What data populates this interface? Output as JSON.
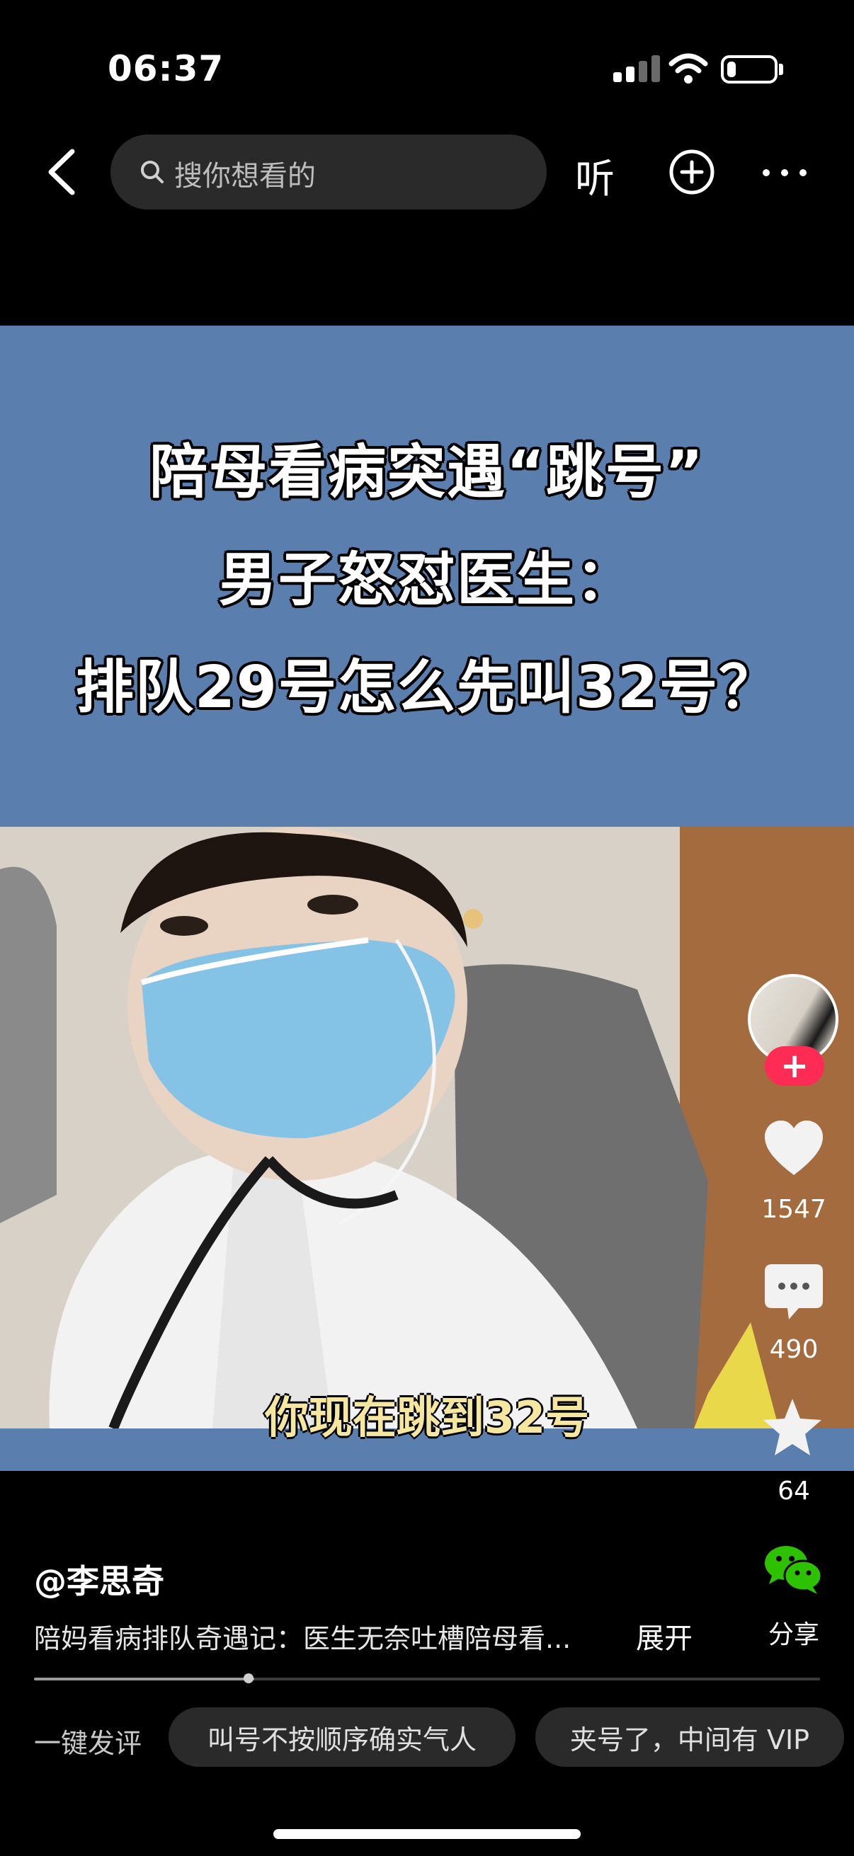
{
  "status_bar": {
    "time": "06:37",
    "icons": [
      "signal-icon",
      "wifi-icon",
      "battery-icon"
    ],
    "battery_level": 0.2
  },
  "top_nav": {
    "back_icon": "chevron-left-icon",
    "search_placeholder": "搜你想看的",
    "listen_label": "听",
    "add_icon": "plus-circle-icon",
    "more_icon": "more-horizontal-icon"
  },
  "video": {
    "headline_lines": [
      "陪母看病突遇“跳号”",
      "男子怒怼医生：",
      "排队29号怎么先叫32号？"
    ],
    "subtitle": "你现在跳到32号"
  },
  "actions": {
    "follow_label": "+",
    "likes": "1547",
    "comments": "490",
    "favorites": "64",
    "share_label": "分享"
  },
  "info": {
    "author": "@李思奇",
    "description": "陪妈看病排队奇遇记：医生无奈吐槽陪母看...",
    "expand_label": "展开",
    "progress": 0.28
  },
  "quick_comments": {
    "label": "一键发评",
    "chips": [
      "叫号不按顺序确实气人",
      "夹号了，中间有 VIP"
    ]
  },
  "colors": {
    "video_bg": "#5a7fae",
    "follow_red": "#fe2c55",
    "wechat_green": "#2dc100"
  }
}
